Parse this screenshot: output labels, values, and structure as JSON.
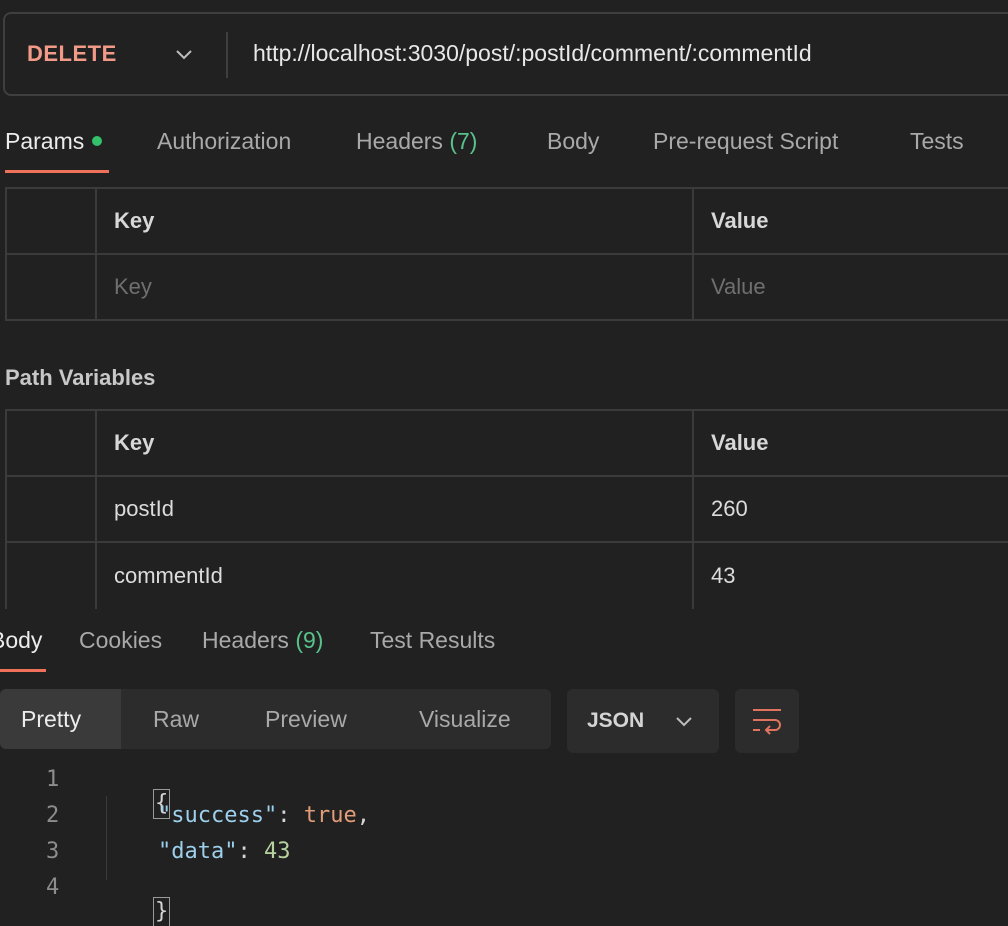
{
  "request": {
    "method": "DELETE",
    "url": "http://localhost:3030/post/:postId/comment/:commentId"
  },
  "request_tabs": [
    {
      "label": "Params",
      "active": true
    },
    {
      "label": "Authorization"
    },
    {
      "label": "Headers",
      "count": "(7)"
    },
    {
      "label": "Body"
    },
    {
      "label": "Pre-request Script"
    },
    {
      "label": "Tests"
    }
  ],
  "query_params": {
    "header_key": "Key",
    "header_value": "Value",
    "key_placeholder": "Key",
    "value_placeholder": "Value"
  },
  "path_variables": {
    "title": "Path Variables",
    "header_key": "Key",
    "header_value": "Value",
    "rows": [
      {
        "key": "postId",
        "value": "260"
      },
      {
        "key": "commentId",
        "value": "43"
      }
    ]
  },
  "response_tabs": [
    {
      "label": "Body",
      "active": true
    },
    {
      "label": "Cookies"
    },
    {
      "label": "Headers",
      "count": "(9)"
    },
    {
      "label": "Test Results"
    }
  ],
  "view_modes": [
    "Pretty",
    "Raw",
    "Preview",
    "Visualize"
  ],
  "format": "JSON",
  "code": {
    "line_numbers": [
      "1",
      "2",
      "3",
      "4"
    ],
    "open_brace": "{",
    "close_brace": "}",
    "success_key": "\"success\"",
    "colon": ": ",
    "success_value": "true",
    "comma": ",",
    "data_key": "\"data\"",
    "data_value": "43"
  }
}
